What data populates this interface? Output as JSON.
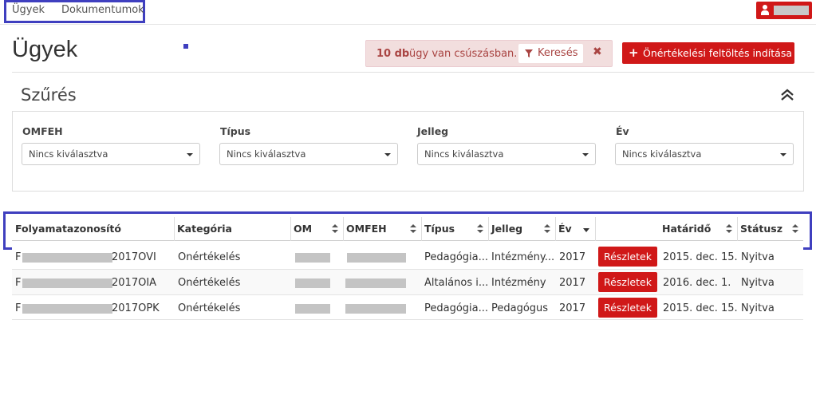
{
  "nav": {
    "items": [
      "Ügyek",
      "Dokumentumok"
    ]
  },
  "header": {
    "title": "Ügyek",
    "alert": {
      "count": "10 db",
      "text": "ügy van csúszásban.",
      "search_label": "Keresés",
      "close": "✖"
    },
    "start_button": "Önértékelési feltöltés indítása"
  },
  "filter": {
    "title": "Szűrés",
    "fields": [
      {
        "label": "OMFEH",
        "value": "Nincs kiválasztva"
      },
      {
        "label": "Típus",
        "value": "Nincs kiválasztva"
      },
      {
        "label": "Jelleg",
        "value": "Nincs kiválasztva"
      },
      {
        "label": "Év",
        "value": "Nincs kiválasztva"
      }
    ]
  },
  "table": {
    "columns": [
      "Folyamatazonosító",
      "Kategória",
      "OM",
      "OMFEH",
      "Típus",
      "Jelleg",
      "Év",
      "",
      "Határidő",
      "Státusz"
    ],
    "rows": [
      {
        "id_prefix": "F",
        "id_suffix": "2017OVI",
        "category": "Önértékelés",
        "type": "Pedagógia...",
        "nature": "Intézmény...",
        "year": "2017",
        "button": "Részletek",
        "deadline": "2015. dec. 15.",
        "status": "Nyitva"
      },
      {
        "id_prefix": "F",
        "id_suffix": "2017OIA",
        "category": "Önértékelés",
        "type": "Általános i...",
        "nature": "Intézmény",
        "year": "2017",
        "button": "Részletek",
        "deadline": "2016. dec. 1.",
        "status": "Nyitva"
      },
      {
        "id_prefix": "F",
        "id_suffix": "2017OPK",
        "category": "Önértékelés",
        "type": "Pedagógia...",
        "nature": "Pedagógus",
        "year": "2017",
        "button": "Részletek",
        "deadline": "2015. dec. 15.",
        "status": "Nyitva"
      }
    ]
  },
  "colors": {
    "accent_red": "#d01818",
    "alert_bg": "#f2dede",
    "alert_text": "#a94442",
    "highlight_outline": "#3f3fbf"
  },
  "icons": [
    "user-icon",
    "funnel-icon",
    "close-icon",
    "plus-icon",
    "double-chevron-up-icon",
    "caret-down-icon",
    "sort-icon"
  ]
}
